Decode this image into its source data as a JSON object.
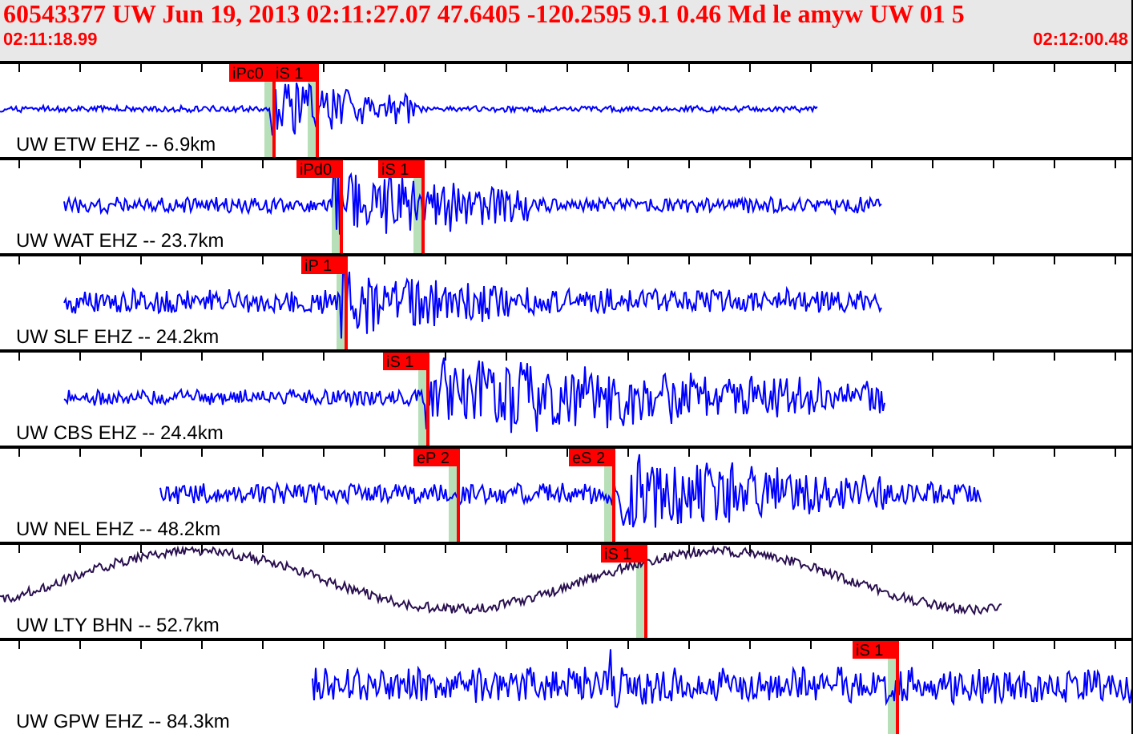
{
  "header": {
    "title": "60543377 UW Jun 19, 2013 02:11:27.07   47.6405 -120.2595  9.1 0.46 Md le amyw UW 01   5",
    "start_time": "02:11:18.99",
    "end_time": "02:12:00.48"
  },
  "traces": [
    {
      "label": "UW ETW EHZ -- 6.9km",
      "kind": "short-period",
      "picks": [
        {
          "label": "iPc0"
        },
        {
          "label": "iS 1"
        }
      ]
    },
    {
      "label": "UW WAT EHZ -- 23.7km",
      "kind": "short-period",
      "picks": [
        {
          "label": "iPd0"
        },
        {
          "label": "iS 1"
        }
      ]
    },
    {
      "label": "UW SLF EHZ -- 24.2km",
      "kind": "short-period",
      "picks": [
        {
          "label": "iP 1"
        }
      ]
    },
    {
      "label": "UW CBS EHZ -- 24.4km",
      "kind": "short-period",
      "picks": [
        {
          "label": "iS 1"
        }
      ]
    },
    {
      "label": "UW NEL EHZ -- 48.2km",
      "kind": "short-period",
      "picks": [
        {
          "label": "eP 2"
        },
        {
          "label": "eS 2"
        }
      ]
    },
    {
      "label": "UW LTY BHN -- 52.7km",
      "kind": "long-period",
      "picks": [
        {
          "label": "iS 1"
        }
      ]
    },
    {
      "label": "UW GPW EHZ -- 84.3km",
      "kind": "short-period",
      "picks": [
        {
          "label": "iS 1"
        }
      ]
    }
  ]
}
